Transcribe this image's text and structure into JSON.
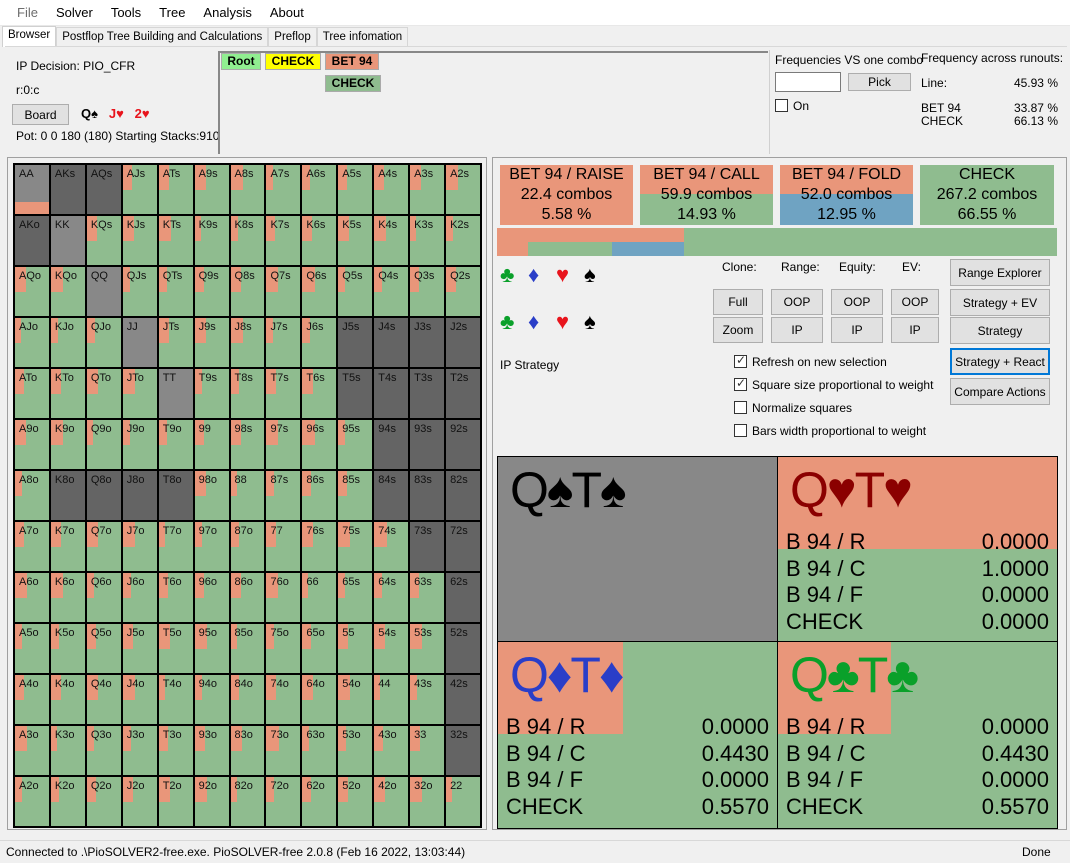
{
  "menu": [
    "File",
    "Solver",
    "Tools",
    "Tree",
    "Analysis",
    "About"
  ],
  "tabs": [
    "Browser",
    "Postflop Tree Building and Calculations",
    "Preflop",
    "Tree infomation"
  ],
  "info": {
    "decision": "IP Decision:  PIO_CFR",
    "node_path": "r:0:c",
    "board_button": "Board",
    "board_cards": [
      {
        "text": "Q♠",
        "color": "#000000"
      },
      {
        "text": "J♥",
        "color": "#e8141c"
      },
      {
        "text": "2♥",
        "color": "#e8141c"
      }
    ],
    "pot": "Pot: 0 0 180 (180) Starting Stacks:910"
  },
  "tree": {
    "nodes": [
      {
        "label": "Root",
        "color": "#90ee90"
      },
      {
        "label": "CHECK",
        "color": "#ffff00"
      },
      {
        "label": "BET 94",
        "color": "#e9967a"
      },
      {
        "label": "CHECK",
        "color": "#8fbc8f"
      }
    ]
  },
  "freq_one_combo": {
    "title": "Frequencies VS one combo",
    "input_value": "",
    "pick_button": "Pick",
    "on_label": "On",
    "on_checked": false
  },
  "runouts": {
    "title": "Frequency across runouts:",
    "line_label": "Line:",
    "line_value": "45.93 %",
    "rows": [
      {
        "label": "BET 94",
        "value": "33.87 %"
      },
      {
        "label": "CHECK",
        "value": "66.13 %"
      }
    ]
  },
  "colors": {
    "raise": "#e9967a",
    "call": "#8fbc8f",
    "fold": "#6fa3c2",
    "check": "#8fbc8f",
    "not_in_range": "#646464",
    "blocked": "#888888"
  },
  "actions": [
    {
      "name": "BET 94 / RAISE",
      "combos": "22.4 combos",
      "pct": "5.58 %"
    },
    {
      "name": "BET 94 / CALL",
      "combos": "59.9 combos",
      "pct": "14.93 %"
    },
    {
      "name": "BET 94 / FOLD",
      "combos": "52.0 combos",
      "pct": "12.95 %"
    },
    {
      "name": "CHECK",
      "combos": "267.2 combos",
      "pct": "66.55 %"
    }
  ],
  "summary_bar": {
    "bet_share": 0.3387,
    "raise": 0.0558,
    "call": 0.1493,
    "fold": 0.1295,
    "check": 0.6655
  },
  "controls": {
    "clone_label": "Clone:",
    "range_label": "Range:",
    "equity_label": "Equity:",
    "ev_label": "EV:",
    "full": "Full",
    "zoom": "Zoom",
    "oop": "OOP",
    "ip": "IP",
    "range_explorer": "Range Explorer",
    "strategy_ev": "Strategy + EV",
    "strategy": "Strategy",
    "strategy_react": "Strategy + React",
    "compare_actions": "Compare Actions",
    "view_label": "IP Strategy",
    "checkboxes": [
      {
        "label": "Refresh on new selection",
        "checked": true
      },
      {
        "label": "Square size proportional to weight",
        "checked": true
      },
      {
        "label": "Normalize squares",
        "checked": false
      },
      {
        "label": "Bars width proportional to weight",
        "checked": false
      }
    ]
  },
  "combos": [
    {
      "title": "Q♠T♠",
      "color": "#000000",
      "blocked": true,
      "rows": []
    },
    {
      "title": "Q♥T♥",
      "color": "#8b0000",
      "blocked": false,
      "rows": [
        {
          "label": "B 94 / R",
          "value": "0.0000"
        },
        {
          "label": "B 94 / C",
          "value": "1.0000"
        },
        {
          "label": "B 94 / F",
          "value": "0.0000"
        },
        {
          "label": "CHECK",
          "value": "0.0000"
        }
      ]
    },
    {
      "title": "Q♦T♦",
      "color": "#2a3ec8",
      "blocked": false,
      "rows": [
        {
          "label": "B 94 / R",
          "value": "0.0000"
        },
        {
          "label": "B 94 / C",
          "value": "0.4430"
        },
        {
          "label": "B 94 / F",
          "value": "0.0000"
        },
        {
          "label": "CHECK",
          "value": "0.5570"
        }
      ]
    },
    {
      "title": "Q♣T♣",
      "color": "#0aa02a",
      "blocked": false,
      "rows": [
        {
          "label": "B 94 / R",
          "value": "0.0000"
        },
        {
          "label": "B 94 / C",
          "value": "0.4430"
        },
        {
          "label": "B 94 / F",
          "value": "0.0000"
        },
        {
          "label": "CHECK",
          "value": "0.5570"
        }
      ]
    }
  ],
  "hand_grid": {
    "ranks": [
      "A",
      "K",
      "Q",
      "J",
      "T",
      "9",
      "8",
      "7",
      "6",
      "5",
      "4",
      "3",
      "2"
    ],
    "cells": {
      "AA": "blocked",
      "AKs": "out",
      "AQs": "out",
      "AKo": "out",
      "KK": "blocked",
      "QQ": "blocked",
      "JJ": "blocked",
      "TT": "blocked",
      "J5s": "out",
      "J4s": "out",
      "J3s": "out",
      "J2s": "out",
      "T5s": "out",
      "T4s": "out",
      "T3s": "out",
      "T2s": "out",
      "94s": "out",
      "93s": "out",
      "92s": "out",
      "84s": "out",
      "83s": "out",
      "82s": "out",
      "73s": "out",
      "72s": "out",
      "62s": "out",
      "52s": "out",
      "42s": "out",
      "32s": "out",
      "K8o": "out",
      "Q8o": "out",
      "J8o": "out",
      "T8o": "out"
    }
  },
  "status": {
    "left": "Connected to .\\PioSOLVER2-free.exe. PioSOLVER-free 2.0.8 (Feb 16 2022, 13:03:44)",
    "right": "Done"
  }
}
